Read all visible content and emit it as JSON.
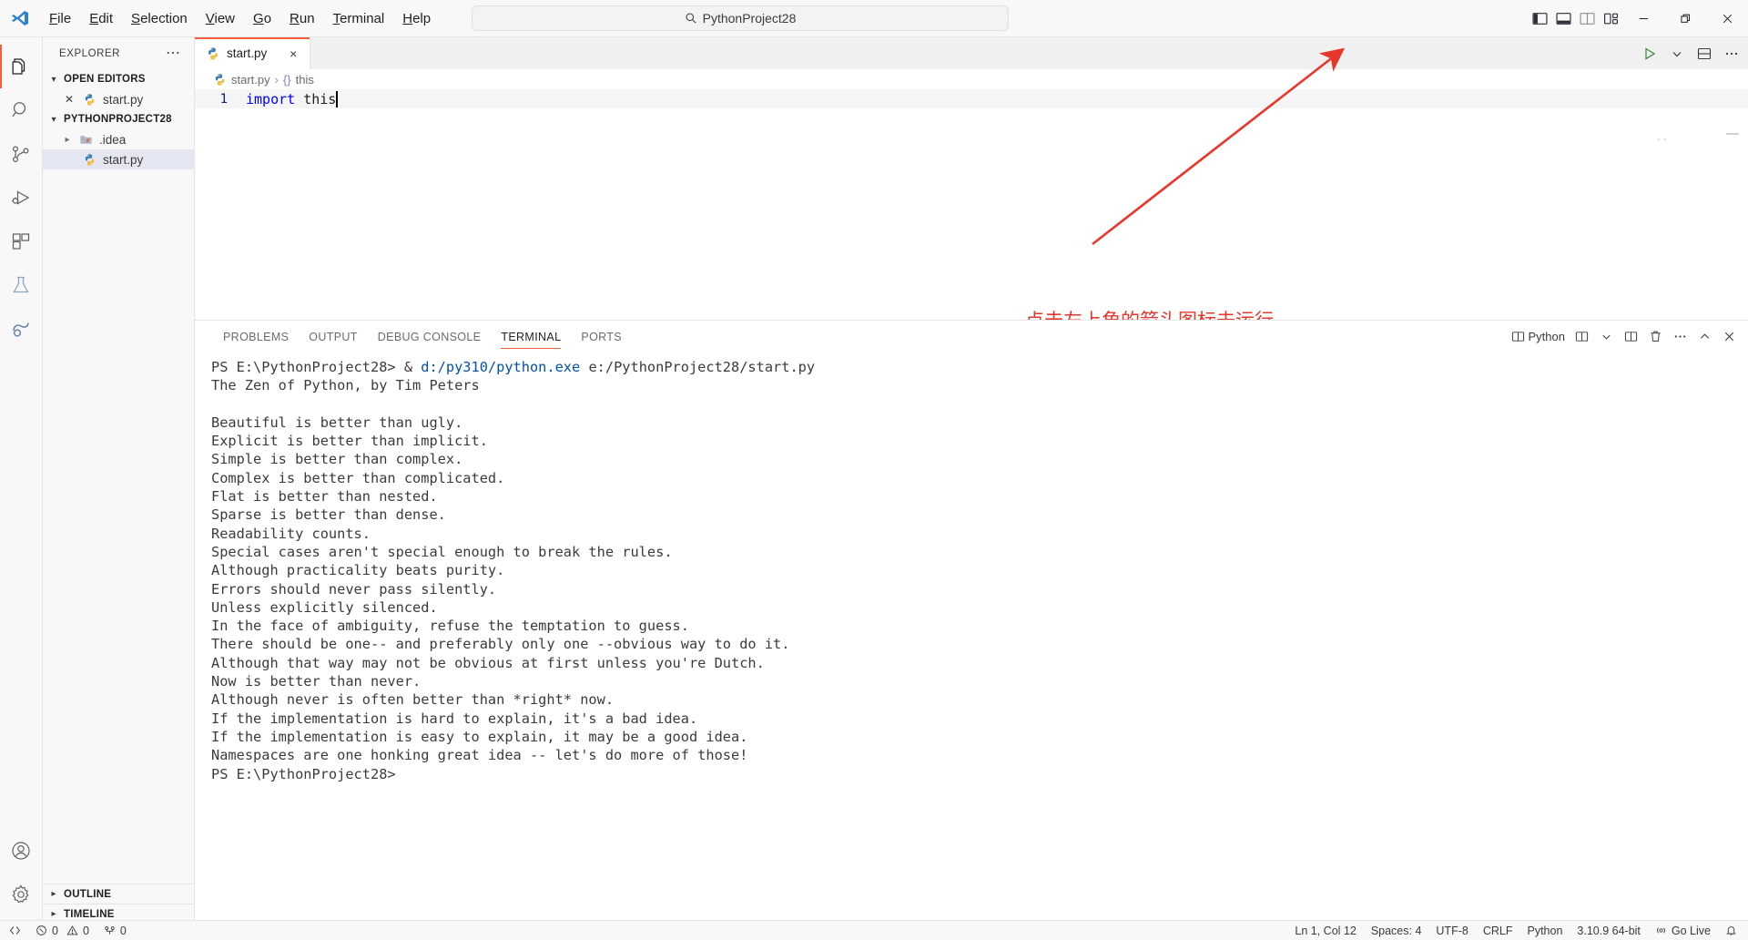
{
  "titlebar": {
    "menus": [
      {
        "label": "File",
        "mnemonic": "F"
      },
      {
        "label": "Edit",
        "mnemonic": "E"
      },
      {
        "label": "Selection",
        "mnemonic": "S"
      },
      {
        "label": "View",
        "mnemonic": "V"
      },
      {
        "label": "Go",
        "mnemonic": "G"
      },
      {
        "label": "Run",
        "mnemonic": "R"
      },
      {
        "label": "Terminal",
        "mnemonic": "T"
      },
      {
        "label": "Help",
        "mnemonic": "H"
      }
    ],
    "quick_open_value": "PythonProject28",
    "back_arrow": "←",
    "forward_arrow": "→",
    "layout_buttons": [
      "toggle-primary-sidebar",
      "toggle-panel",
      "toggle-secondary-sidebar",
      "customize-layout"
    ],
    "window_controls": [
      "minimize",
      "restore",
      "close"
    ]
  },
  "activitybar": {
    "items": [
      {
        "name": "explorer",
        "active": true
      },
      {
        "name": "search",
        "active": false
      },
      {
        "name": "source-control",
        "active": false
      },
      {
        "name": "run-and-debug",
        "active": false
      },
      {
        "name": "extensions",
        "active": false
      },
      {
        "name": "testing",
        "active": false
      },
      {
        "name": "anaconda",
        "active": false
      }
    ],
    "bottom_items": [
      {
        "name": "accounts"
      },
      {
        "name": "manage-settings"
      }
    ]
  },
  "sidebar": {
    "title": "EXPLORER",
    "more_actions": "⋯",
    "sections": [
      {
        "label": "OPEN EDITORS",
        "expanded": true,
        "items": [
          {
            "name": "start.py",
            "icon": "python-file-icon",
            "closeable": true
          }
        ]
      },
      {
        "label": "PYTHONPROJECT28",
        "expanded": true,
        "items": [
          {
            "name": ".idea",
            "icon": "folder-idea-icon",
            "expandable": true,
            "expanded": false
          },
          {
            "name": "start.py",
            "icon": "python-file-icon",
            "selected": true
          }
        ]
      }
    ],
    "bottom_panes": [
      {
        "label": "OUTLINE",
        "expanded": false
      },
      {
        "label": "TIMELINE",
        "expanded": false
      }
    ]
  },
  "editor": {
    "tabs": [
      {
        "label": "start.py",
        "icon": "python-file-icon",
        "active": true,
        "close": "×"
      }
    ],
    "tab_actions": [
      "run-python-file",
      "run-dropdown-chevron",
      "split-editor",
      "more-actions"
    ],
    "breadcrumb": {
      "file": "start.py",
      "separator": "›",
      "symbol_icon": "{}",
      "symbol": "this"
    },
    "lines": [
      {
        "number": "1",
        "keyword": "import",
        "rest": " this"
      }
    ]
  },
  "annotation": {
    "text": "点击左上角的箭头图标去运行",
    "color": "#e03a2f"
  },
  "panel": {
    "tabs": [
      {
        "label": "PROBLEMS",
        "active": false
      },
      {
        "label": "OUTPUT",
        "active": false
      },
      {
        "label": "DEBUG CONSOLE",
        "active": false
      },
      {
        "label": "TERMINAL",
        "active": true
      },
      {
        "label": "PORTS",
        "active": false
      }
    ],
    "actions": {
      "shell_label": "Python",
      "icons": [
        "launch-profile-icon",
        "split-terminal-icon",
        "chevron-down-icon",
        "split-icon",
        "kill-terminal-icon",
        "more-actions-icon",
        "maximize-panel-icon",
        "close-panel-icon"
      ]
    },
    "terminal": {
      "prompt_1": "PS E:\\PythonProject28>",
      "command_amp": " & ",
      "command_path": "d:/py310/python.exe",
      "command_arg": " e:/PythonProject28/start.py",
      "output": [
        "The Zen of Python, by Tim Peters",
        "",
        "Beautiful is better than ugly.",
        "Explicit is better than implicit.",
        "Simple is better than complex.",
        "Complex is better than complicated.",
        "Flat is better than nested.",
        "Sparse is better than dense.",
        "Readability counts.",
        "Special cases aren't special enough to break the rules.",
        "Although practicality beats purity.",
        "Errors should never pass silently.",
        "Unless explicitly silenced.",
        "In the face of ambiguity, refuse the temptation to guess.",
        "There should be one-- and preferably only one --obvious way to do it.",
        "Although that way may not be obvious at first unless you're Dutch.",
        "Now is better than never.",
        "Although never is often better than *right* now.",
        "If the implementation is hard to explain, it's a bad idea.",
        "If the implementation is easy to explain, it may be a good idea.",
        "Namespaces are one honking great idea -- let's do more of those!"
      ],
      "prompt_2": "PS E:\\PythonProject28>"
    }
  },
  "statusbar": {
    "left": [
      {
        "name": "remote-window",
        "label": "",
        "icon": "remote-icon"
      },
      {
        "name": "problems",
        "label": "0",
        "icon": "error-icon",
        "label2": "0",
        "icon2": "warning-icon"
      },
      {
        "name": "ports",
        "label": "0",
        "icon": "ports-icon"
      }
    ],
    "errors": "0",
    "warnings": "0",
    "ports": "0",
    "right": [
      {
        "name": "cursor-position",
        "label": "Ln 1, Col 12"
      },
      {
        "name": "indentation",
        "label": "Spaces: 4"
      },
      {
        "name": "encoding",
        "label": "UTF-8"
      },
      {
        "name": "eol",
        "label": "CRLF"
      },
      {
        "name": "language-mode",
        "label": "Python"
      },
      {
        "name": "python-interpreter",
        "label": "3.10.9 64-bit"
      },
      {
        "name": "go-live",
        "label": "Go Live"
      },
      {
        "name": "notifications",
        "label": ""
      }
    ]
  }
}
